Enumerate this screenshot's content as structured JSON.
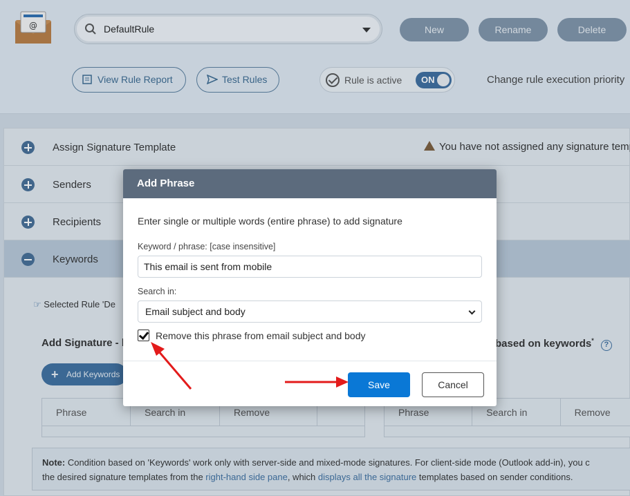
{
  "app": {
    "rule_selector": {
      "value": "DefaultRule"
    },
    "top_buttons": {
      "new": "New",
      "rename": "Rename",
      "delete": "Delete"
    },
    "view_rule_report": "View Rule Report",
    "test_rules": "Test Rules",
    "rule_active": {
      "label": "Rule is active",
      "switch": "ON",
      "state": true
    },
    "change_priority": "Change rule execution priority"
  },
  "accordion": [
    {
      "label": "Assign Signature Template",
      "expanded": false
    },
    {
      "label": "Senders",
      "expanded": false
    },
    {
      "label": "Recipients",
      "expanded": false
    },
    {
      "label": "Keywords",
      "expanded": true
    }
  ],
  "warning": "You have not assigned any signature temp",
  "keywords_section": {
    "selected_rule": "Selected Rule 'De",
    "add_signature": "Add Signature - b",
    "add_keywords_button": "Add Keywords",
    "based_on_keywords": "based on keywords",
    "based_marker": "*",
    "help_icon_glyph": "?",
    "left_table_headers": [
      "Phrase",
      "Search in",
      "Remove",
      ""
    ],
    "right_table_headers": [
      "Phrase",
      "Search in",
      "Remove"
    ]
  },
  "note": {
    "strong": "Note:",
    "line1": " Condition based on 'Keywords' work only with server-side and mixed-mode signatures. For client-side mode (Outlook add-in), you c",
    "line2_pre": "the desired signature templates from the ",
    "link1": "right-hand side pane",
    "line2_mid": ", which ",
    "link2": "displays all the signature",
    "line2_post": " templates based on sender conditions."
  },
  "modal": {
    "title": "Add Phrase",
    "instruction": "Enter single or multiple words (entire phrase) to add signature",
    "keyword_label": "Keyword / phrase: [case insensitive]",
    "keyword_value": "This email is sent from mobile",
    "search_in_label": "Search in:",
    "search_in_value": "Email subject and body",
    "remove_phrase_label": "Remove this phrase from email subject and body",
    "remove_phrase_checked": true,
    "save": "Save",
    "cancel": "Cancel"
  },
  "colors": {
    "annotation_arrow": "#e31b1b",
    "save_button": "#0a78d6",
    "modal_header": "#5c6b7d"
  }
}
